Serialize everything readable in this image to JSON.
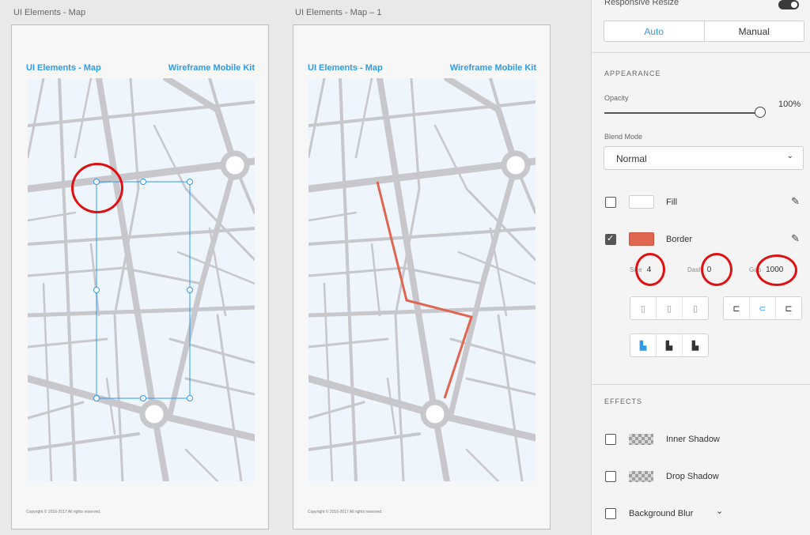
{
  "canvas": {
    "artboard1_label": "UI Elements - Map",
    "artboard2_label": "UI Elements - Map – 1",
    "artboard_title": "UI Elements - Map",
    "artboard_kit": "Wireframe Mobile Kit",
    "copyright": "Copyright © 2016-2017 All rights reserved."
  },
  "panel": {
    "responsive_resize": "Responsive Resize",
    "seg_auto": "Auto",
    "seg_manual": "Manual",
    "appearance": "APPEARANCE",
    "opacity_label": "Opacity",
    "opacity_value": "100%",
    "opacity_level": 1.0,
    "blend_mode_label": "Blend Mode",
    "blend_mode_value": "Normal",
    "fill_label": "Fill",
    "fill_color": "#ffffff",
    "border_label": "Border",
    "border_color": "#e06650",
    "size_label": "Size",
    "size_value": "4",
    "dash_label": "Dash",
    "dash_value": "0",
    "gap_label": "Gap",
    "gap_value": "1000",
    "effects": "EFFECTS",
    "inner_shadow": "Inner Shadow",
    "drop_shadow": "Drop Shadow",
    "background_blur": "Background Blur"
  },
  "colors": {
    "accent": "#2e9bea",
    "path": "#e06650",
    "annotation": "#e01010",
    "road": "#c7c7cc"
  }
}
